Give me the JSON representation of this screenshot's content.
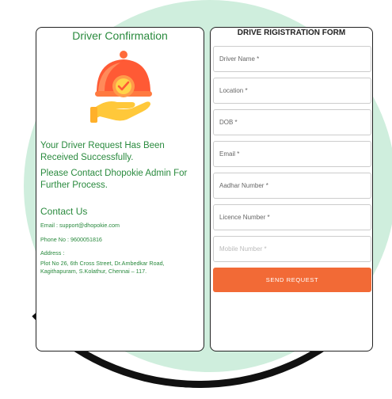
{
  "confirmation": {
    "title": "Driver Confirmation",
    "message_received": "Your Driver Request Has Been Received Successfully.",
    "message_contact": "Please Contact Dhopokie Admin For Further Process.",
    "contact_title": "Contact Us",
    "email": "Email : support@dhopokie.com",
    "phone": "Phone No : 9600051816",
    "address_label": "Address :",
    "address": "Plot No 26, 6th Cross Street, Dr.Ambedkar Road, Kagithapuram, S.Kolathur, Chennai – 117.",
    "icon": "served-dish-check-icon"
  },
  "form": {
    "title": "DRIVE RIGISTRATION FORM",
    "fields": [
      {
        "placeholder": "Driver Name *"
      },
      {
        "placeholder": "Location *"
      },
      {
        "placeholder": "DOB *"
      },
      {
        "placeholder": "Email *"
      },
      {
        "placeholder": "Aadhar Number *"
      },
      {
        "placeholder": "Licence Number *"
      },
      {
        "placeholder": "Mobile Number *"
      }
    ],
    "submit_label": "SEND REQUEST"
  },
  "colors": {
    "accent_green": "#2a8a3e",
    "button_orange": "#f26a36",
    "background_circle": "#cfeedd"
  }
}
